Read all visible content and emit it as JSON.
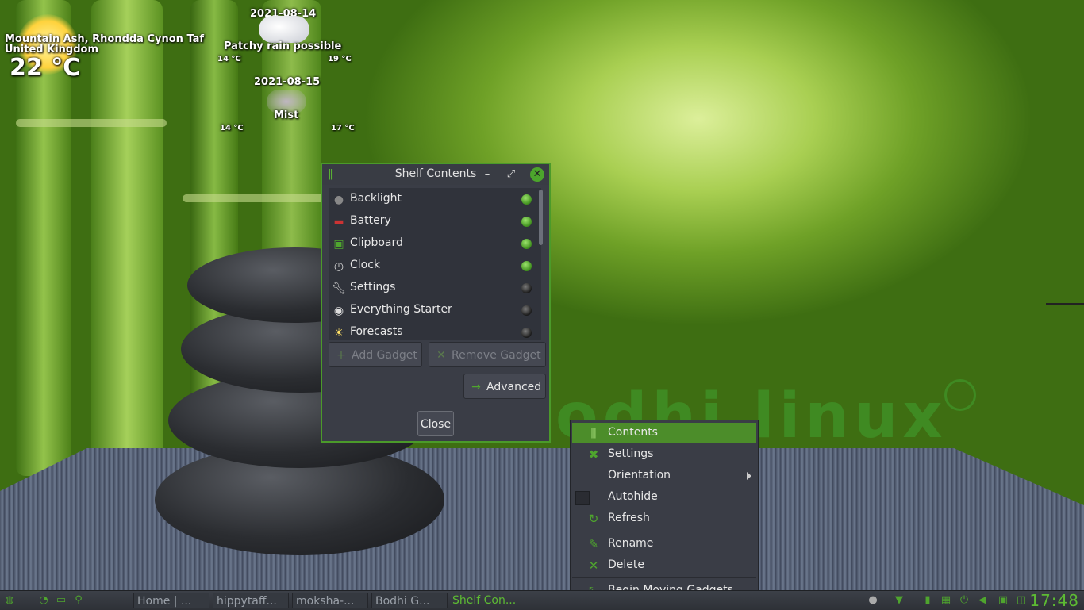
{
  "weather": {
    "location_line1": "Mountain Ash, Rhondda Cynon Taf",
    "location_line2": "United Kingdom",
    "current_temp": "22 °C",
    "day1": {
      "date": "2021-08-14",
      "condition": "Patchy rain possible",
      "low": "14 °C",
      "high": "19 °C",
      "icon": "rain-cloud-icon"
    },
    "day2": {
      "date": "2021-08-15",
      "condition": "Mist",
      "low": "14 °C",
      "high": "17 °C",
      "icon": "mist-icon"
    }
  },
  "desktop": {
    "logo_text": "odhi linux"
  },
  "dialog": {
    "title": "Shelf Contents",
    "minimize": "–",
    "maximize": "⤢",
    "close": "✕",
    "gadgets": [
      {
        "label": "Backlight",
        "icon": "lightbulb-icon",
        "enabled": true
      },
      {
        "label": "Battery",
        "icon": "battery-icon",
        "enabled": true
      },
      {
        "label": "Clipboard",
        "icon": "clipboard-icon",
        "enabled": true
      },
      {
        "label": "Clock",
        "icon": "clock-icon",
        "enabled": true
      },
      {
        "label": "Settings",
        "icon": "wrench-icon",
        "enabled": false
      },
      {
        "label": "Everything Starter",
        "icon": "everything-icon",
        "enabled": false
      },
      {
        "label": "Forecasts",
        "icon": "sun-icon",
        "enabled": false
      }
    ],
    "add_gadget": "Add Gadget",
    "remove_gadget": "Remove Gadget",
    "advanced": "Advanced",
    "close_button": "Close"
  },
  "context_menu": {
    "items": [
      {
        "label": "Contents",
        "icon": "shelf-icon"
      },
      {
        "label": "Settings",
        "icon": "tools-icon"
      },
      {
        "label": "Orientation",
        "icon": ""
      },
      {
        "label": "Autohide",
        "icon": "checkbox"
      },
      {
        "label": "Refresh",
        "icon": "refresh-icon"
      },
      {
        "label": "Rename",
        "icon": "pencil-icon"
      },
      {
        "label": "Delete",
        "icon": "x-icon"
      },
      {
        "label": "Begin Moving Gadgets",
        "icon": "move-icon"
      }
    ],
    "accent": "#4c8d2a"
  },
  "taskbar": {
    "tasks": [
      {
        "label": "Home | ..."
      },
      {
        "label": "hippytaff..."
      },
      {
        "label": "moksha-..."
      },
      {
        "label": "Bodhi G..."
      },
      {
        "label": "Shelf Con..."
      }
    ],
    "clock": "17:48"
  },
  "colors": {
    "accent_green": "#4fa52e",
    "panel_bg": "#3a3d46"
  }
}
